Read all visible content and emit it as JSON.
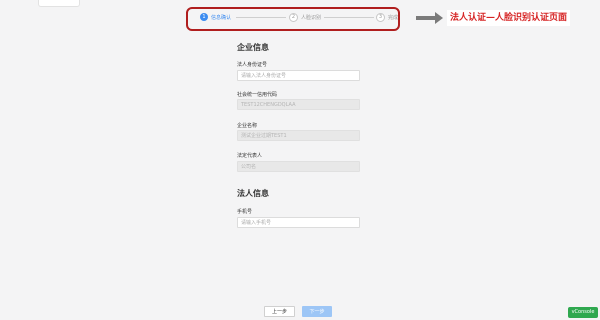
{
  "steps": [
    {
      "number": "1",
      "label": "信息确认",
      "state": "active"
    },
    {
      "number": "2",
      "label": "人脸识别",
      "state": "idle"
    },
    {
      "number": "3",
      "label": "完成",
      "state": "idle"
    }
  ],
  "annotation": {
    "text": "法人认证—人脸识别认证页面",
    "color": "#d62424",
    "box_color": "#b01e1e"
  },
  "enterprise_section": {
    "title": "企业信息",
    "fields": [
      {
        "label": "法人身份证号",
        "placeholder": "请输入法人身份证号",
        "value": "",
        "disabled": false
      },
      {
        "label": "社会统一信用代码",
        "placeholder": "",
        "value": "TEST12CHENGDQLAA",
        "disabled": true
      },
      {
        "label": "企业名称",
        "placeholder": "",
        "value": "测试企业过期TEST1",
        "disabled": true
      },
      {
        "label": "法定代表人",
        "placeholder": "",
        "value": "公司名",
        "disabled": true
      }
    ]
  },
  "legal_person_section": {
    "title": "法人信息",
    "fields": [
      {
        "label": "手机号",
        "placeholder": "请输入手机号",
        "value": "",
        "disabled": false
      }
    ]
  },
  "buttons": {
    "prev": "上一步",
    "next": "下一步"
  },
  "vconsole": {
    "label": "vConsole",
    "color": "#2fa84f"
  },
  "accent_color": "#3c8cf0"
}
